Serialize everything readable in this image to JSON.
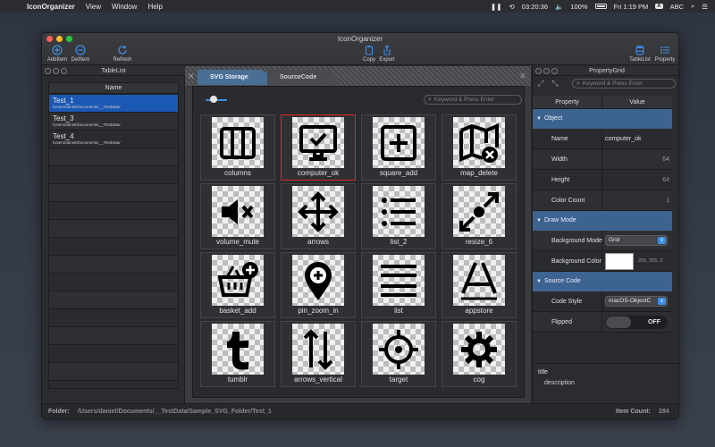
{
  "menubar": {
    "app_name": "IconOrganizer",
    "menus": [
      "View",
      "Window",
      "Help"
    ],
    "clock_time": "03:20:36",
    "battery": "100%",
    "datetime": "Fri 1:19 PM",
    "input_badge": "A",
    "input_source": "ABC"
  },
  "window": {
    "title": "IconOrganizer",
    "toolbar": {
      "add_item": "AddItem",
      "del_item": "DelItem",
      "refresh": "Refresh",
      "copy": "Copy",
      "export": "Export",
      "tablelist": "TableList",
      "property": "Property"
    }
  },
  "tablelist": {
    "title": "TableList",
    "column": "Name",
    "rows": [
      {
        "name": "Test_1",
        "path": "/Users/daniel/Documents/__TestData/",
        "selected": true
      },
      {
        "name": "Test_3",
        "path": "/Users/daniel/Documents/__TestData/",
        "selected": false
      },
      {
        "name": "Test_4",
        "path": "/Users/daniel/Documents/__TestData/",
        "selected": false
      }
    ],
    "search_placeholder": "Keyword & Press Enter"
  },
  "center": {
    "tabs": [
      "SVG Storage",
      "SourceCode"
    ],
    "search_placeholder": "Keyword & Press Enter",
    "slider_level": 0.3,
    "icons": [
      {
        "name": "columns",
        "icon": "columns-icon"
      },
      {
        "name": "computer_ok",
        "icon": "computer-ok-icon",
        "selected": true
      },
      {
        "name": "square_add",
        "icon": "square-add-icon"
      },
      {
        "name": "map_delete",
        "icon": "map-delete-icon"
      },
      {
        "name": "volume_mute",
        "icon": "volume-mute-icon"
      },
      {
        "name": "arrows",
        "icon": "arrows-icon"
      },
      {
        "name": "list_2",
        "icon": "list-2-icon"
      },
      {
        "name": "resize_6",
        "icon": "resize-6-icon"
      },
      {
        "name": "basket_add",
        "icon": "basket-add-icon"
      },
      {
        "name": "pin_zoom_in",
        "icon": "pin-zoom-in-icon"
      },
      {
        "name": "list",
        "icon": "list-icon"
      },
      {
        "name": "appstore",
        "icon": "appstore-icon"
      },
      {
        "name": "tumblr",
        "icon": "tumblr-icon"
      },
      {
        "name": "arrows_vertical",
        "icon": "arrows-vertical-icon"
      },
      {
        "name": "target",
        "icon": "target-icon"
      },
      {
        "name": "cog",
        "icon": "cog-icon"
      }
    ]
  },
  "propgrid": {
    "title": "PropertyGrid",
    "search_placeholder": "Keyword & Press Enter",
    "col_property": "Property",
    "col_value": "Value",
    "object_section": "Object",
    "name_label": "Name",
    "name_value": "computer_ok",
    "width_label": "Width",
    "width_value": "64",
    "height_label": "Height",
    "height_value": "64",
    "colorcount_label": "Color Count",
    "colorcount_value": "1",
    "drawmode_section": "Draw Mode",
    "bgmode_label": "Background Mode",
    "bgmode_value": "Grid",
    "bgcolor_label": "Background Color",
    "bgcolor_value": "255, 255, 2",
    "bgcolor_hex": "#ffffff",
    "source_section": "Source Code",
    "codestyle_label": "Code Style",
    "codestyle_value": "macOS-ObjectC",
    "flipped_label": "Flipped",
    "flipped_value": "OFF",
    "desc_title": "title",
    "desc_text": "description"
  },
  "statusbar": {
    "folder_label": "Folder:",
    "folder_path": "/Users/daniel/Documents/__TestData/Sample_SVG_Folder/Test_1",
    "count_label": "Item Count:",
    "count_value": "284"
  },
  "colors": {
    "accent": "#3d8fe8",
    "selection": "#1b58b4",
    "category": "#3d6391",
    "selected_border": "#e02828"
  }
}
